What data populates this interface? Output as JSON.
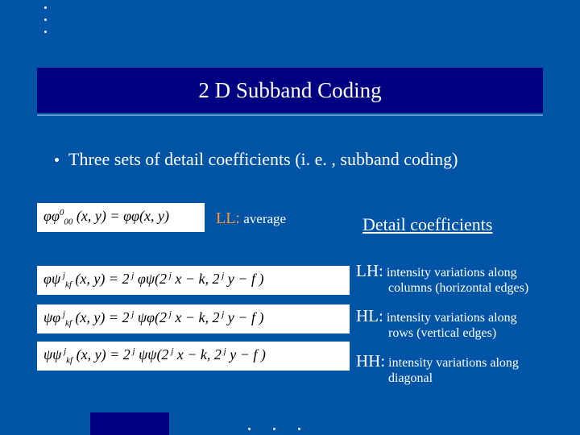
{
  "title": "2 D Subband Coding",
  "bullet": "Three sets of detail coefficients (i. e. , subband coding)",
  "ll": {
    "prefix": "LL:",
    "text": " average"
  },
  "detail_header": "Detail coefficients",
  "equations": {
    "ll_eq": "φφ₀₀⁰(x, y) = φφ(x, y)",
    "lh_eq": "φψₖfʲ(x, y) = 2ʲ φψ(2ʲ x − k, 2ʲ y − f)",
    "hl_eq": "ψφₖfʲ(x, y) = 2ʲ ψφ(2ʲ x − k, 2ʲ y − f)",
    "hh_eq": "ψψₖfʲ(x, y) = 2ʲ ψψ(2ʲ x − k, 2ʲ y − f)"
  },
  "subbands": {
    "lh": {
      "label": "LH:",
      "desc": " intensity variations along",
      "desc2": "columns (horizontal edges)"
    },
    "hl": {
      "label": "HL:",
      "desc": " intensity variations along",
      "desc2": "rows (vertical edges)"
    },
    "hh": {
      "label": "HH:",
      "desc": " intensity variations along",
      "desc2": "diagonal"
    }
  }
}
